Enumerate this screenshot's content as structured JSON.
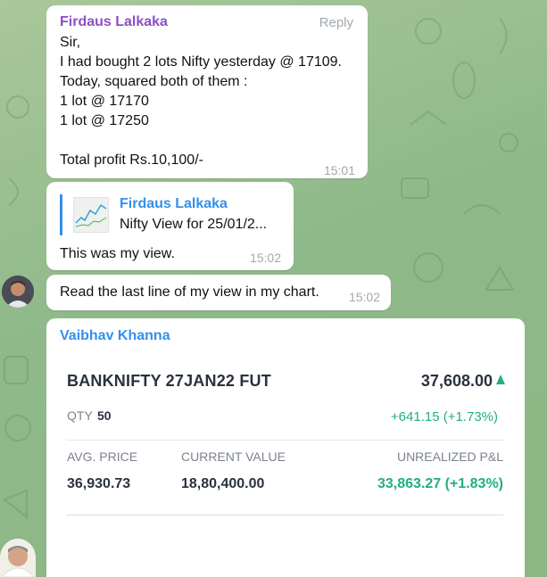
{
  "messages": [
    {
      "sender": "Firdaus Lalkaka",
      "reply_label": "Reply",
      "text": "Sir,\nI had bought 2 lots Nifty yesterday @ 17109.\nToday, squared both of them :\n1 lot @ 17170\n1 lot @ 17250\n\nTotal profit Rs.10,100/-",
      "time": "15:01"
    },
    {
      "quoted_sender": "Firdaus Lalkaka",
      "quoted_text": "Nifty View for 25/01/2...",
      "text": "This was my view.",
      "time": "15:02"
    },
    {
      "text": "Read the last line of my view in my chart.",
      "time": "15:02"
    },
    {
      "sender": "Vaibhav Khanna",
      "position_card": {
        "symbol": "BANKNIFTY 27JAN22 FUT",
        "ltp": "37,608.00",
        "qty_label": "QTY",
        "qty_value": "50",
        "change": "+641.15 (+1.73%)",
        "avg_price_label": "AVG. PRICE",
        "avg_price": "36,930.73",
        "current_value_label": "CURRENT VALUE",
        "current_value": "18,80,400.00",
        "pnl_label": "UNREALIZED P&L",
        "pnl": "33,863.27 (+1.83%)"
      }
    }
  ],
  "colors": {
    "sender_purple": "#8e4ec6",
    "sender_blue": "#3390ec",
    "profit_green": "#21b07a",
    "background": "#9fc193"
  },
  "icons": [
    "up-triangle-icon"
  ]
}
